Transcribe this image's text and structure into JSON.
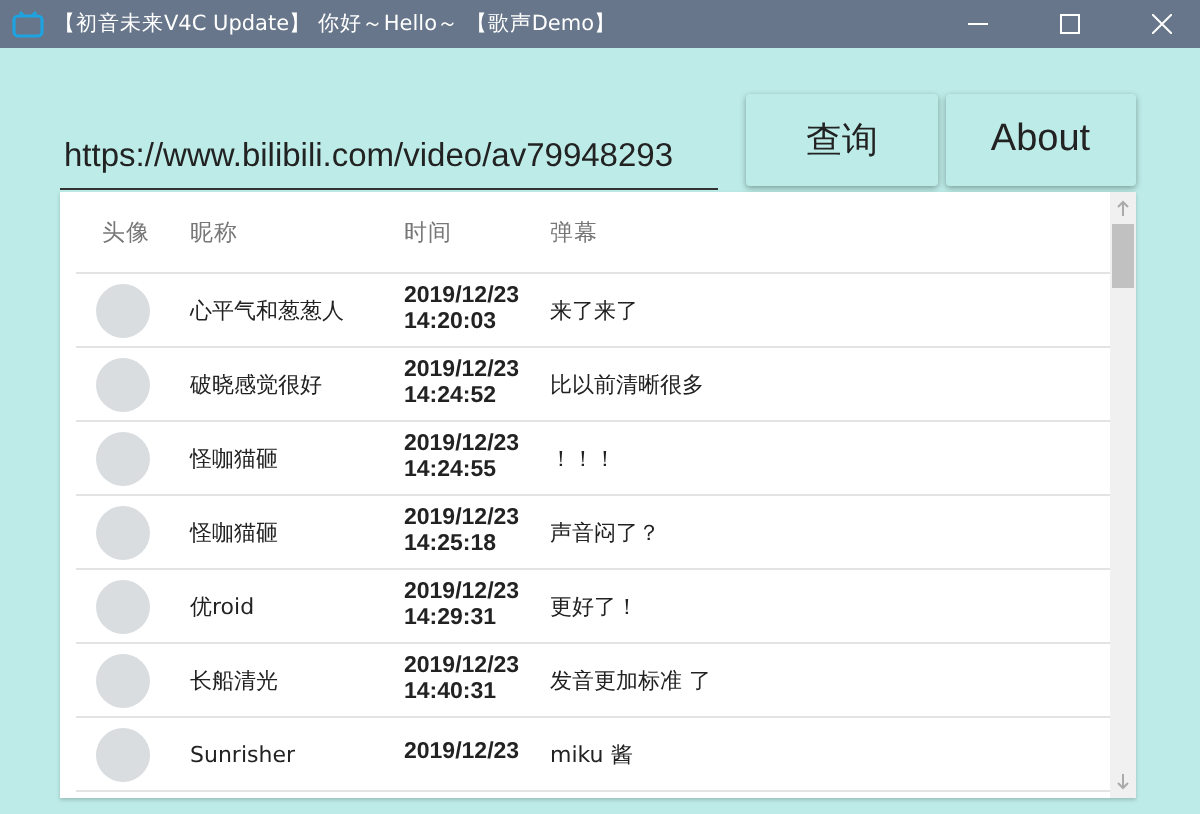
{
  "window": {
    "title": "【初音未来V4C Update】 你好～Hello～ 【歌声Demo】"
  },
  "url_field": {
    "value": "https://www.bilibili.com/video/av79948293"
  },
  "buttons": [
    "查询",
    "About"
  ],
  "table": {
    "columns": [
      "头像",
      "昵称",
      "时间",
      "弹幕"
    ],
    "rows": [
      {
        "name": "心平气和葱葱人",
        "date": "2019/12/23",
        "time": "14:20:03",
        "text": "来了来了"
      },
      {
        "name": "破晓感觉很好",
        "date": "2019/12/23",
        "time": "14:24:52",
        "text": "比以前清晰很多"
      },
      {
        "name": "怪咖猫砸",
        "date": "2019/12/23",
        "time": "14:24:55",
        "text": "！！！"
      },
      {
        "name": "怪咖猫砸",
        "date": "2019/12/23",
        "time": "14:25:18",
        "text": "声音闷了？"
      },
      {
        "name": "优roid",
        "date": "2019/12/23",
        "time": "14:29:31",
        "text": "更好了！"
      },
      {
        "name": "长船清光",
        "date": "2019/12/23",
        "time": "14:40:31",
        "text": "发音更加标准 了"
      },
      {
        "name": "Sunrisher",
        "date": "2019/12/23",
        "time": "",
        "text": "miku 酱"
      }
    ]
  }
}
